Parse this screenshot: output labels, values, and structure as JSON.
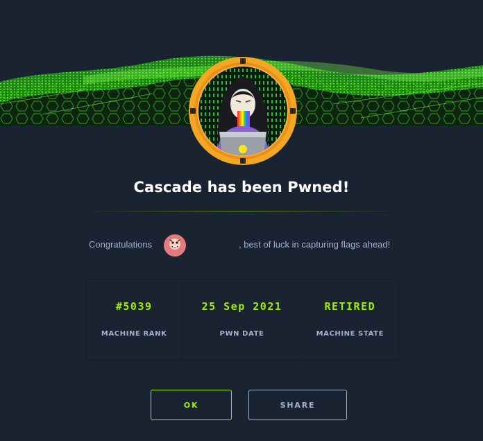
{
  "banner": {
    "accent_color": "#9fef00",
    "background_color": "#141d2b"
  },
  "machine_avatar": {
    "icon": "machine-avatar-icon",
    "ring_color": "#f5a623"
  },
  "title": "Cascade has been Pwned!",
  "congrats": {
    "prefix": "Congratulations",
    "suffix": ", best of luck in capturing flags ahead!",
    "user_avatar_icon": "user-avatar-icon"
  },
  "stats": [
    {
      "value": "#5039",
      "label": "MACHINE RANK"
    },
    {
      "value": "25 Sep 2021",
      "label": "PWN DATE"
    },
    {
      "value": "RETIRED",
      "label": "MACHINE STATE"
    }
  ],
  "buttons": {
    "ok_label": "OK",
    "share_label": "SHARE"
  },
  "colors": {
    "background": "#1a2332",
    "accent": "#9fef00",
    "muted_text": "#a4b1cd"
  }
}
